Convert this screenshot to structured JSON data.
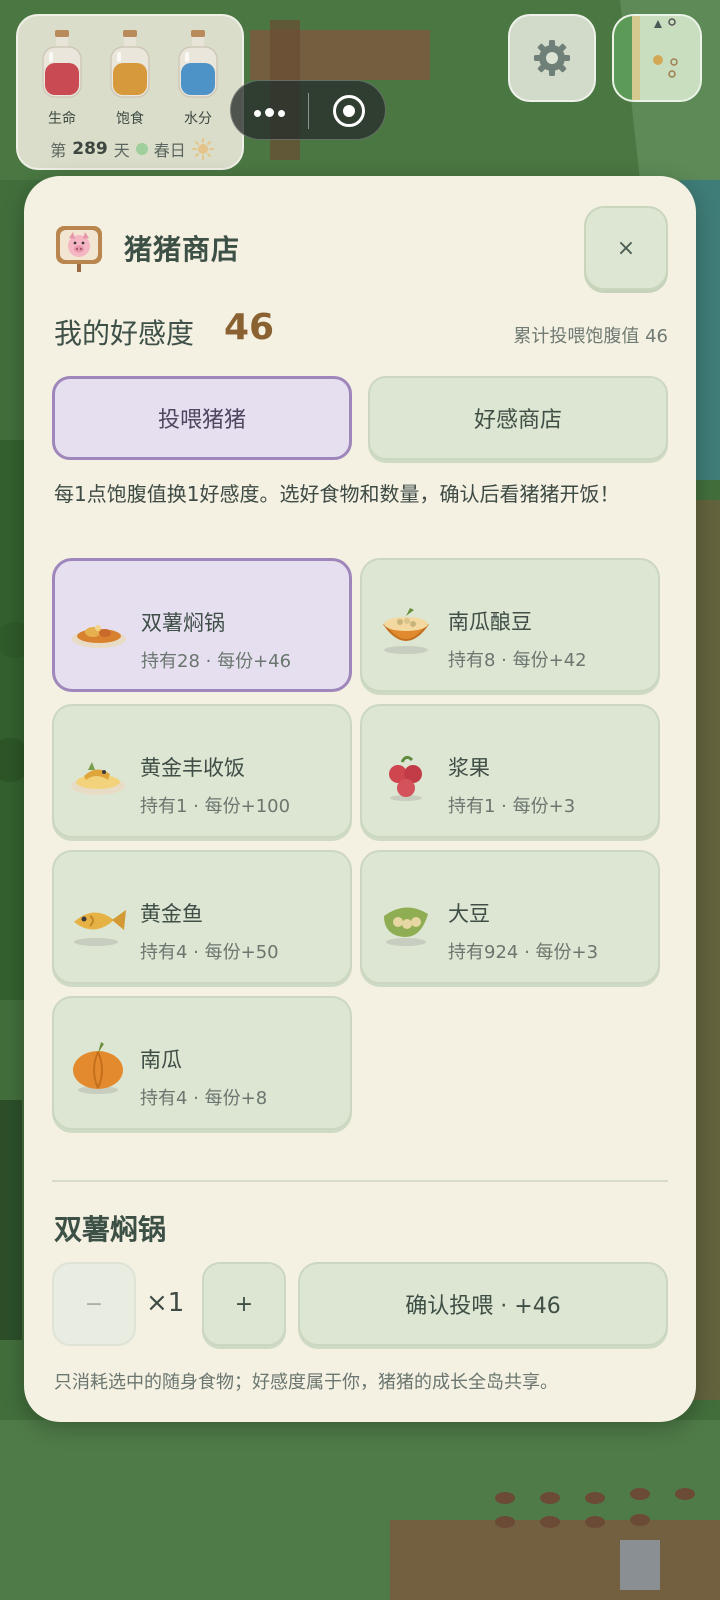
{
  "hud": {
    "stats": [
      {
        "label": "生命",
        "color": "#c94a52"
      },
      {
        "label": "饱食",
        "color": "#d69a3c"
      },
      {
        "label": "水分",
        "color": "#4d93c8"
      }
    ],
    "day_prefix": "第",
    "day_number": "289",
    "day_suffix": "天",
    "season": "春日",
    "weather_icon": "sun-icon"
  },
  "shop": {
    "title": "猪猪商店",
    "icon": "pig-sign-icon",
    "close_label": "×",
    "favor_label": "我的好感度",
    "favor_value": "46",
    "fed_total": "累计投喂饱腹值 46",
    "tabs": [
      {
        "label": "投喂猪猪",
        "active": true
      },
      {
        "label": "好感商店",
        "active": false
      }
    ],
    "hint": "每1点饱腹值换1好感度。选好食物和数量，确认后看猪猪开饭！",
    "foods": [
      {
        "name": "双薯焖锅",
        "sub": "持有28 · 每份+46",
        "icon": "stew-icon",
        "selected": true
      },
      {
        "name": "南瓜酿豆",
        "sub": "持有8 · 每份+42",
        "icon": "stuffed-pumpkin-icon",
        "selected": false
      },
      {
        "name": "黄金丰收饭",
        "sub": "持有1 · 每份+100",
        "icon": "harvest-rice-icon",
        "selected": false
      },
      {
        "name": "浆果",
        "sub": "持有1 · 每份+3",
        "icon": "berry-icon",
        "selected": false
      },
      {
        "name": "黄金鱼",
        "sub": "持有4 · 每份+50",
        "icon": "golden-fish-icon",
        "selected": false
      },
      {
        "name": "大豆",
        "sub": "持有924 · 每份+3",
        "icon": "soybean-icon",
        "selected": false
      },
      {
        "name": "南瓜",
        "sub": "持有4 · 每份+8",
        "icon": "pumpkin-icon",
        "selected": false
      }
    ],
    "selected_name": "双薯焖锅",
    "qty_minus": "−",
    "qty_value": "×1",
    "qty_plus": "+",
    "confirm_label": "确认投喂 · +46",
    "footnote": "只消耗选中的随身食物；好感度属于你，猪猪的成长全岛共享。"
  }
}
